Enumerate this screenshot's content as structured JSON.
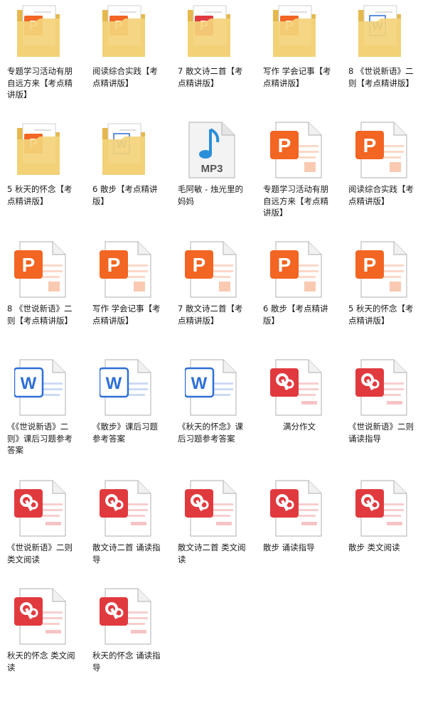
{
  "items": [
    {
      "type": "folder-ppt",
      "label": "专题学习活动有朋自远方来【考点精讲版】"
    },
    {
      "type": "folder-ppt",
      "label": "阅读综合实践【考点精讲版】"
    },
    {
      "type": "folder-ppt-red",
      "label": "7 散文诗二首【考点精讲版】"
    },
    {
      "type": "folder-ppt",
      "label": "写作 学会记事【考点精讲版】"
    },
    {
      "type": "folder-word",
      "label": "8 《世说新语》二则【考点精讲版】"
    },
    {
      "type": "folder-ppt2",
      "label": "5 秋天的怀念【考点精讲版】"
    },
    {
      "type": "folder-word",
      "label": "6 散步【考点精讲版】"
    },
    {
      "type": "mp3",
      "label": "毛阿敏 - 烛光里的妈妈",
      "badge": "MP3"
    },
    {
      "type": "ppt",
      "label": "专题学习活动有朋自远方来【考点精讲版】"
    },
    {
      "type": "ppt",
      "label": "阅读综合实践【考点精讲版】"
    },
    {
      "type": "ppt",
      "label": "8 《世说新语》二则【考点精讲版】"
    },
    {
      "type": "ppt",
      "label": "写作 学会记事【考点精讲版】"
    },
    {
      "type": "ppt",
      "label": "7 散文诗二首【考点精讲版】"
    },
    {
      "type": "ppt",
      "label": "6 散步【考点精讲版】"
    },
    {
      "type": "ppt",
      "label": "5 秋天的怀念【考点精讲版】"
    },
    {
      "type": "word",
      "label": "《《世说新语》二则》课后习题参考答案"
    },
    {
      "type": "word",
      "label": "《散步》课后习题参考答案"
    },
    {
      "type": "word",
      "label": "《秋天的怀念》课后习题参考答案"
    },
    {
      "type": "pdf",
      "label": "满分作文",
      "center": true
    },
    {
      "type": "pdf",
      "label": "《世说新语》二则 诵读指导"
    },
    {
      "type": "pdf",
      "label": "《世说新语》二则 类文阅读"
    },
    {
      "type": "pdf",
      "label": "散文诗二首 诵读指导"
    },
    {
      "type": "pdf",
      "label": "散文诗二首 类文阅读"
    },
    {
      "type": "pdf",
      "label": "散步 诵读指导"
    },
    {
      "type": "pdf",
      "label": "散步 类文阅读"
    },
    {
      "type": "pdf",
      "label": "秋天的怀念 类文阅读"
    },
    {
      "type": "pdf",
      "label": "秋天的怀念 诵读指导"
    }
  ],
  "colors": {
    "folder": "#f4d27a",
    "folderDark": "#e6b84c",
    "ppt": "#f26522",
    "pptDark": "#d8501a",
    "word": "#2f6fd6",
    "pdf": "#e03a3e",
    "paper": "#ffffff",
    "line": "#d5d5d5"
  }
}
